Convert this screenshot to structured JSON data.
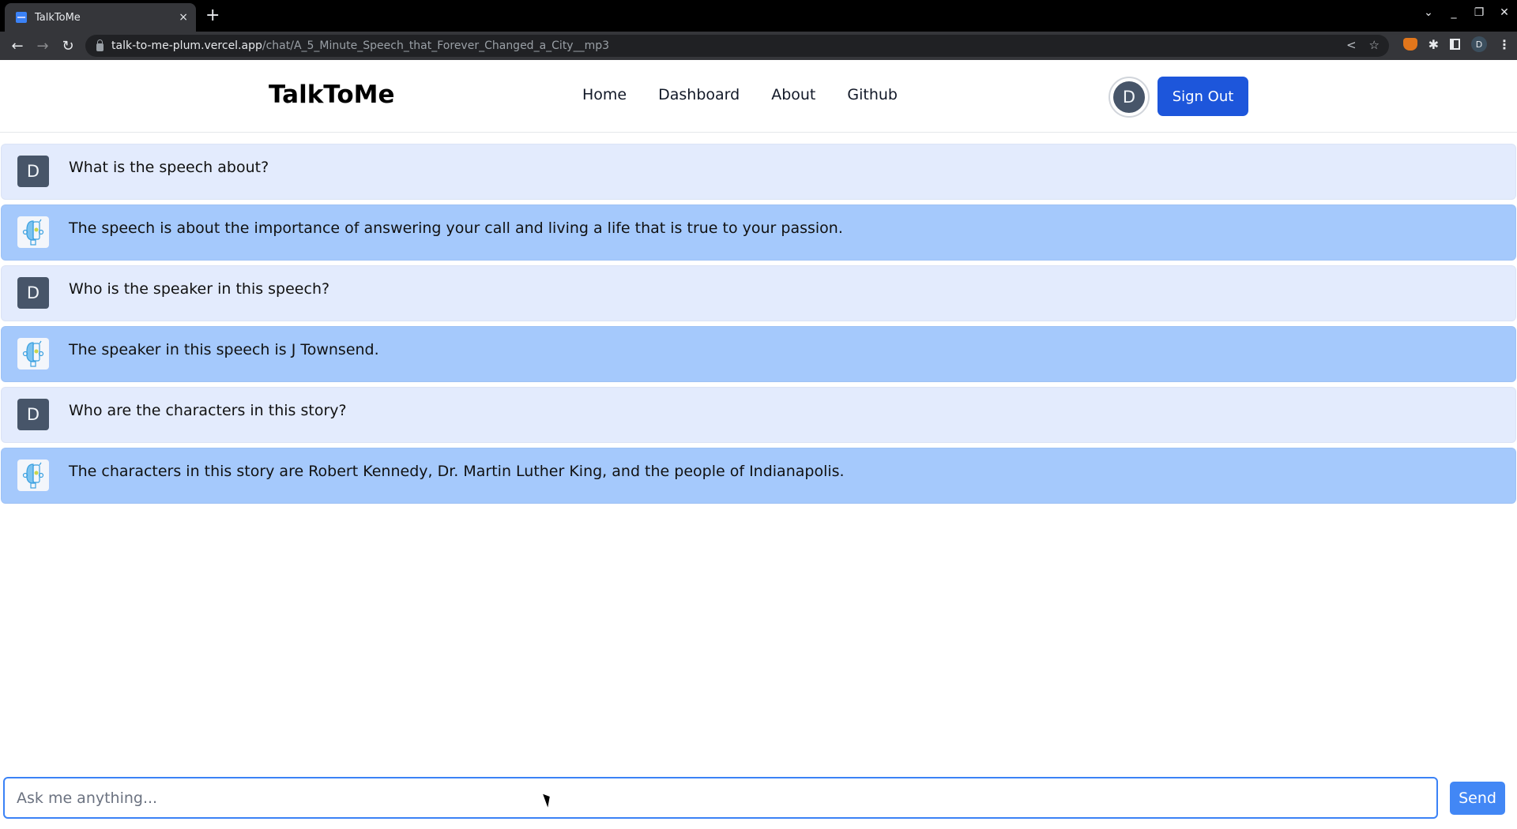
{
  "browser": {
    "tab_title": "TalkToMe",
    "tab_close": "×",
    "new_tab": "+",
    "url_host": "talk-to-me-plum.vercel.app",
    "url_path": "/chat/A_5_Minute_Speech_that_Forever_Changed_a_City__mp3",
    "profile_initial": "D",
    "icons": {
      "back": "←",
      "forward": "→",
      "reload": "↻",
      "share": "<",
      "star": "☆",
      "puzzle": "✱",
      "menu": "⋮",
      "tab_list": "⌄",
      "minimize": "_",
      "restore": "❐",
      "close": "✕"
    }
  },
  "header": {
    "logo": "TalkToMe",
    "nav": [
      {
        "label": "Home"
      },
      {
        "label": "Dashboard"
      },
      {
        "label": "About"
      },
      {
        "label": "Github"
      }
    ],
    "user_initial": "D",
    "sign_out_label": "Sign Out"
  },
  "chat": {
    "messages": [
      {
        "role": "user",
        "avatar": "D",
        "text": "What is the speech about?"
      },
      {
        "role": "bot",
        "avatar": "robot-icon",
        "text": "The speech is about the importance of answering your call and living a life that is true to your passion."
      },
      {
        "role": "user",
        "avatar": "D",
        "text": "Who is the speaker in this speech?"
      },
      {
        "role": "bot",
        "avatar": "robot-icon",
        "text": "The speaker in this speech is J Townsend."
      },
      {
        "role": "user",
        "avatar": "D",
        "text": "Who are the characters in this story?"
      },
      {
        "role": "bot",
        "avatar": "robot-icon",
        "text": "The characters in this story are Robert Kennedy, Dr. Martin Luther King, and the people of Indianapolis."
      }
    ]
  },
  "composer": {
    "placeholder": "Ask me anything...",
    "value": "",
    "send_label": "Send"
  },
  "colors": {
    "user_row": "#e3ebfd",
    "bot_row": "#a5c9fc",
    "primary_button": "#1d56db",
    "send_button": "#4287f5",
    "avatar": "#475569"
  }
}
